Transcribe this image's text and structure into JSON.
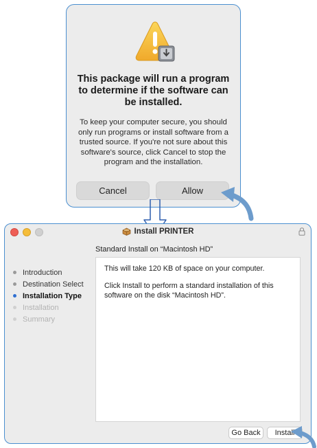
{
  "dialog": {
    "title": "This package will run a program to determine if the software can be installed.",
    "message": "To keep your computer secure, you should only run programs or install software from a trusted source. If you're not sure about this software's source, click Cancel to stop the program and the installation.",
    "cancel_label": "Cancel",
    "allow_label": "Allow",
    "icon": "warning-package-icon"
  },
  "installer": {
    "window_title": "Install PRINTER",
    "subtitle": "Standard Install on “Macintosh HD”",
    "steps": [
      {
        "label": "Introduction",
        "state": "done"
      },
      {
        "label": "Destination Select",
        "state": "done"
      },
      {
        "label": "Installation Type",
        "state": "active"
      },
      {
        "label": "Installation",
        "state": "pending"
      },
      {
        "label": "Summary",
        "state": "pending"
      }
    ],
    "content": {
      "line1": "This will take 120 KB of space on your computer.",
      "line2": "Click Install to perform a standard installation of this software on the disk “Macintosh HD”."
    },
    "go_back_label": "Go Back",
    "install_label": "Install",
    "icons": [
      "package-icon",
      "lock-icon"
    ]
  },
  "colors": {
    "highlight_border": "#4a8fd0",
    "arrow": "#6d9ccc",
    "active_step": "#2f6fd1"
  }
}
